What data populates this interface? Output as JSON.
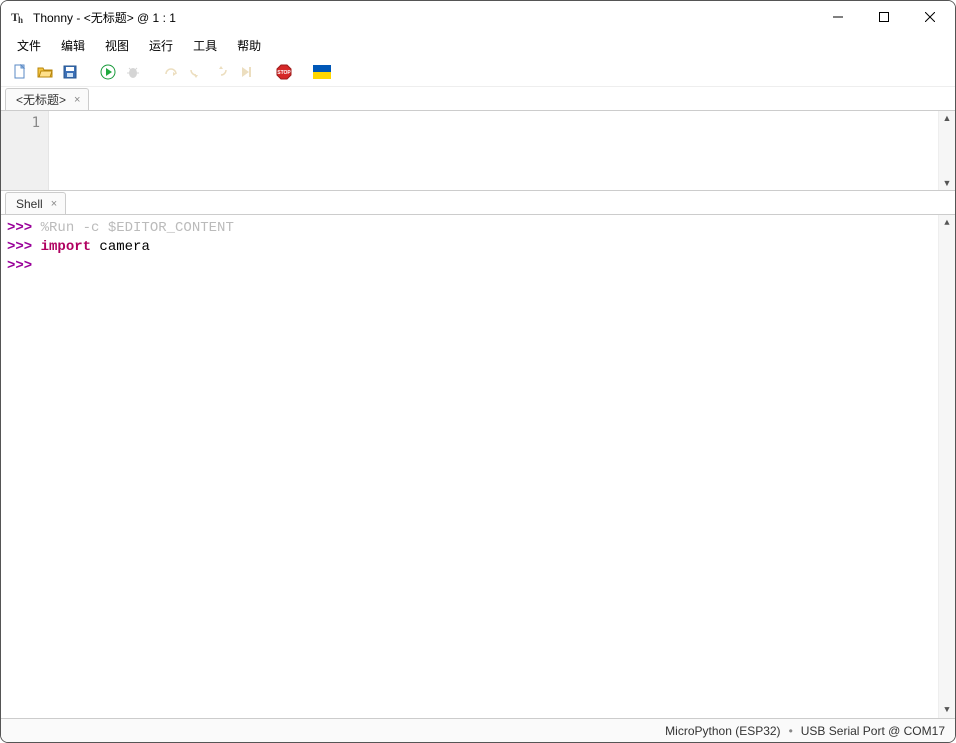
{
  "window": {
    "title": "Thonny  -  <无标题>  @  1 : 1"
  },
  "menu": {
    "items": [
      "文件",
      "编辑",
      "视图",
      "运行",
      "工具",
      "帮助"
    ]
  },
  "editor_tab": {
    "label": "<无标题>",
    "close_glyph": "×"
  },
  "editor": {
    "line_number": "1",
    "content": ""
  },
  "shell_tab": {
    "label": "Shell",
    "close_glyph": "×"
  },
  "shell": {
    "lines": [
      {
        "prompt": ">>> ",
        "dim": "%Run -c $EDITOR_CONTENT"
      },
      {
        "prompt": ">>> ",
        "kw": "import",
        "txt": " camera"
      },
      {
        "prompt": ">>> "
      }
    ]
  },
  "status": {
    "interpreter": "MicroPython (ESP32)",
    "separator": "•",
    "port": "USB Serial Port @ COM17",
    "watermark": ""
  },
  "icons": {
    "new": "new-file-icon",
    "open": "open-folder-icon",
    "save": "save-icon",
    "run": "run-icon",
    "debug": "debug-icon",
    "stepover": "step-over-icon",
    "stepinto": "step-into-icon",
    "stepout": "step-out-icon",
    "resume": "resume-icon",
    "stop": "stop-icon",
    "flag": "ukraine-flag-icon"
  }
}
